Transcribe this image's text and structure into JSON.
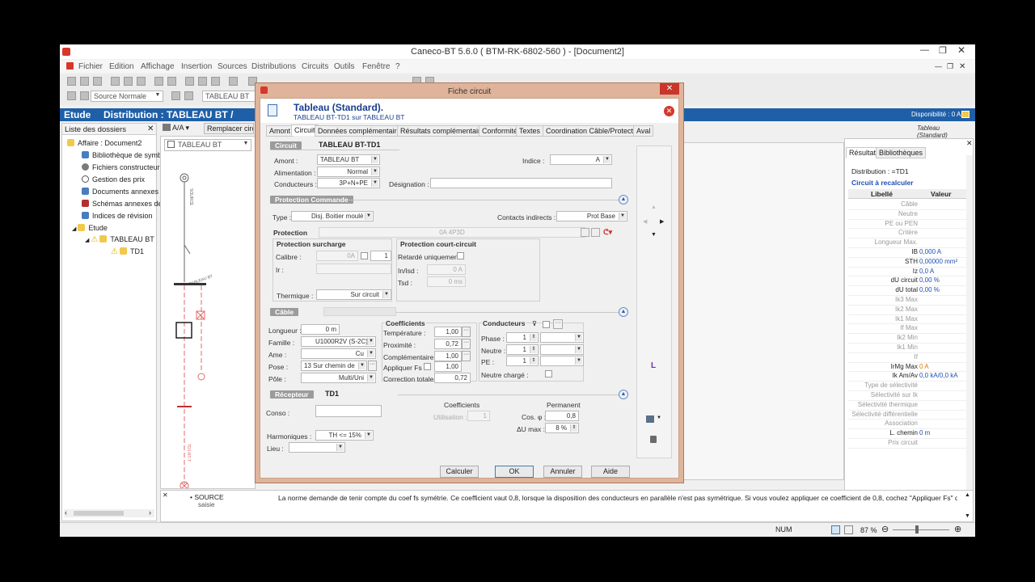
{
  "window": {
    "title": "Caneco-BT 5.6.0 ( BTM-RK-6802-560 ) - [Document2]"
  },
  "menu": [
    "Fichier",
    "Edition",
    "Affichage",
    "Insertion",
    "Sources",
    "Distributions",
    "Circuits",
    "Outils",
    "Fenêtre",
    "?"
  ],
  "toolbar": {
    "source_combo": "Source Normale",
    "tableau_combo": "TABLEAU BT"
  },
  "bluebar": {
    "etude": "Etude",
    "distribution": "Distribution : TABLEAU BT /",
    "disponibilite": "Disponibilité : 0 A"
  },
  "left_panel": {
    "header": "Liste des dossiers",
    "items": [
      "Affaire : Document2",
      "Bibliothèque de symbo",
      "Fichiers constructeur",
      "Gestion des prix",
      "Documents annexes p",
      "Schémas annexes de",
      "Indices de révision",
      "Etude",
      "TABLEAU BT",
      "TD1"
    ]
  },
  "schema": {
    "zoom_btn": "A/A",
    "replace_btn": "Remplacer circui",
    "combo": "TABLEAU BT",
    "source_label": "SOURCE",
    "tableau_label": "TABLEAU BT",
    "td1_label": "TD1-BT-T"
  },
  "right_header_text": "Tableau (Standard)",
  "results": {
    "tabs": [
      "Résultats",
      "Bibliothèques"
    ],
    "distribution": "Distribution : =TD1",
    "recalc": "Circuit à recalculer",
    "col_libelle": "Libellé",
    "col_valeur": "Valeur",
    "rows": [
      {
        "k": "Câble",
        "v": ""
      },
      {
        "k": "Neutre",
        "v": ""
      },
      {
        "k": "PE ou PEN",
        "v": ""
      },
      {
        "k": "Critère",
        "v": ""
      },
      {
        "k": "Longueur Max.",
        "v": ""
      },
      {
        "k": "IB",
        "v": "0,000 A",
        "bold": true
      },
      {
        "k": "STH",
        "v": "0,00000 mm²",
        "bold": true
      },
      {
        "k": "Iz",
        "v": "0,0 A",
        "bold": true
      },
      {
        "k": "dU circuit",
        "v": "0,00 %",
        "bold": true
      },
      {
        "k": "dU total",
        "v": "0,00 %",
        "bold": true
      },
      {
        "k": "Ik3 Max",
        "v": ""
      },
      {
        "k": "Ik2 Max",
        "v": ""
      },
      {
        "k": "Ik1 Max",
        "v": ""
      },
      {
        "k": "If Max",
        "v": ""
      },
      {
        "k": "Ik2 Min",
        "v": ""
      },
      {
        "k": "Ik1 Min",
        "v": ""
      },
      {
        "k": "If",
        "v": ""
      },
      {
        "k": "IrMg Max",
        "v": "0 A",
        "bold": true,
        "orange": true
      },
      {
        "k": "Ik Am/Av",
        "v": "0,0 kA/0,0 kA",
        "bold": true
      },
      {
        "k": "Type de sélectivité",
        "v": ""
      },
      {
        "k": "Sélectivité sur Ik",
        "v": ""
      },
      {
        "k": "Sélectivité thermique",
        "v": ""
      },
      {
        "k": "Sélectivité différentielle",
        "v": ""
      },
      {
        "k": "Association",
        "v": ""
      },
      {
        "k": "L. chemin",
        "v": "0 m",
        "bold": true
      },
      {
        "k": "Prix circuit",
        "v": ""
      }
    ]
  },
  "bottom": {
    "item": "SOURCE",
    "sub": "saisie",
    "message": "La norme demande de tenir compte du coef fs symétrie. Ce coefficient vaut 0,8, lorsque la disposition des conducteurs en parallèle n'est pas symétrique. Si vous voulez appliquer ce coefficient de 0,8, cochez \"Appliquer Fs\" dans l'écran de"
  },
  "status": {
    "num": "NUM",
    "zoom": "87 %"
  },
  "dialog": {
    "title": "Fiche circuit",
    "heading": "Tableau (Standard).",
    "subheading": "TABLEAU BT-TD1 sur TABLEAU BT",
    "tabs": [
      "Amont",
      "Circuit",
      "Données complémentaires",
      "Résultats complémentaires",
      "Conformité",
      "Textes",
      "Coordination Câble/Protection",
      "Aval"
    ],
    "circuit_tag": "Circuit",
    "circuit_name": "TABLEAU BT-TD1",
    "amont_label": "Amont :",
    "amont_value": "TABLEAU BT",
    "alimentation_label": "Alimentation :",
    "alimentation_value": "Normal",
    "conducteurs_label": "Conducteurs :",
    "conducteurs_value": "3P+N+PE",
    "indice_label": "Indice :",
    "indice_value": "A",
    "designation_label": "Désignation :",
    "protection_commande": "Protection Commande",
    "type_label": "Type :",
    "type_value": "Disj. Boitier moulé",
    "contacts_label": "Contacts indirects :",
    "contacts_value": "Prot Base",
    "protection_label": "Protection",
    "protection_value": "0A 4P3D",
    "surcharge_title": "Protection surcharge",
    "calibre_label": "Calibre :",
    "calibre_value": "0A",
    "calibre_count": "1",
    "ir_label": "Ir :",
    "thermique_label": "Thermique :",
    "thermique_value": "Sur circuit",
    "cc_title": "Protection court-circuit",
    "retarde_label": "Retardé uniquement",
    "inisd_label": "In/Isd :",
    "inisd_value": "0 A",
    "tsd_label": "Tsd :",
    "tsd_value": "0 ms",
    "cable": "Câble",
    "longueur_label": "Longueur :",
    "longueur_value": "0 m",
    "famille_label": "Famille :",
    "famille_value": "U1000R2V (S-2C)",
    "ame_label": "Ame :",
    "ame_value": "Cu",
    "pose_label": "Pose :",
    "pose_value": "13  Sur chemin de",
    "pole_label": "Pôle :",
    "pole_value": "Multi/Uni",
    "coef_title": "Coefficients",
    "temp_label": "Température :",
    "temp_value": "1,00",
    "prox_label": "Proximité :",
    "prox_value": "0,72",
    "compl_label": "Complémentaire :",
    "compl_value": "1,00",
    "fs_label": "Appliquer Fs :",
    "fs_value": "1,00",
    "corr_label": "Correction totale :",
    "corr_value": "0,72",
    "cond_title": "Conducteurs",
    "phase_label": "Phase :",
    "phase_value": "1",
    "neutre_label": "Neutre :",
    "neutre_value": "1",
    "pe_label": "PE :",
    "pe_value": "1",
    "neutre_charge_label": "Neutre chargé :",
    "recepteur": "Récepteur",
    "recepteur_name": "TD1",
    "conso_label": "Conso :",
    "coefficients_label": "Coefficients",
    "utilisation_label": "Utilisation :",
    "utilisation_value": "1",
    "permanent_label": "Permanent",
    "cosphi_label": "Cos. φ :",
    "cosphi_value": "0,8",
    "du_label": "ΔU max :",
    "du_value": "8 %",
    "harmoniques_label": "Harmoniques :",
    "harmoniques_value": "TH <= 15%",
    "lieu_label": "Lieu :",
    "btn_calculer": "Calculer",
    "btn_ok": "OK",
    "btn_annuler": "Annuler",
    "btn_aide": "Aide"
  }
}
